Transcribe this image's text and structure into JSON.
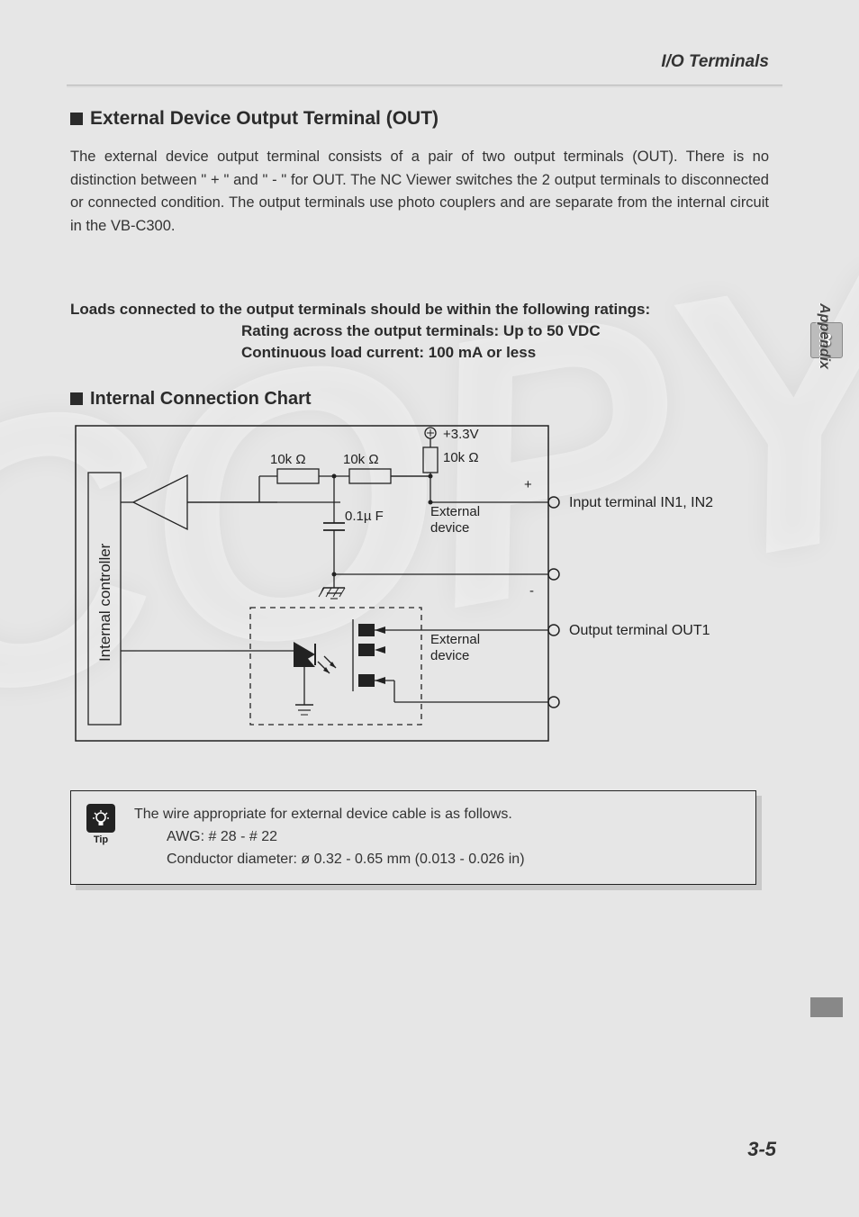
{
  "header": {
    "breadcrumb": "I/O Terminals"
  },
  "section1": {
    "title": "External Device Output Terminal (OUT)",
    "body": "The external device output terminal consists of a pair of two output terminals (OUT). There is no distinction between \" + \" and \" - \" for OUT. The NC Viewer switches the 2 output terminals to disconnected or connected condition. The output terminals use photo couplers and are separate from the internal circuit in the VB-C300."
  },
  "ratings": {
    "line1": "Loads connected to the output terminals should be within the following ratings:",
    "line2": "Rating across the output terminals: Up to 50 VDC",
    "line3": "Continuous load current: 100 mA or less"
  },
  "section2": {
    "title": "Internal Connection Chart"
  },
  "chart_data": {
    "type": "diagram",
    "labels": {
      "internal_controller": "Internal controller",
      "voltage": "+3.3V",
      "r_pullup": "10k Ω",
      "r1": "10k Ω",
      "r2": "10k Ω",
      "cap": "0.1µ F",
      "ext_dev1": "External device",
      "ext_dev2": "External device",
      "in_label": "Input terminal IN1, IN2",
      "out_label": "Output terminal OUT1",
      "plus": "+",
      "minus": "-"
    }
  },
  "tip": {
    "label": "Tip",
    "line1": "The wire appropriate for external device cable is as follows.",
    "line2": "AWG: # 28 - # 22",
    "line3": "Conductor diameter: ø 0.32 - 0.65 mm (0.013 - 0.026 in)"
  },
  "side": {
    "chapter": "3",
    "label": "Appendix"
  },
  "footer": {
    "page": "3-5"
  }
}
